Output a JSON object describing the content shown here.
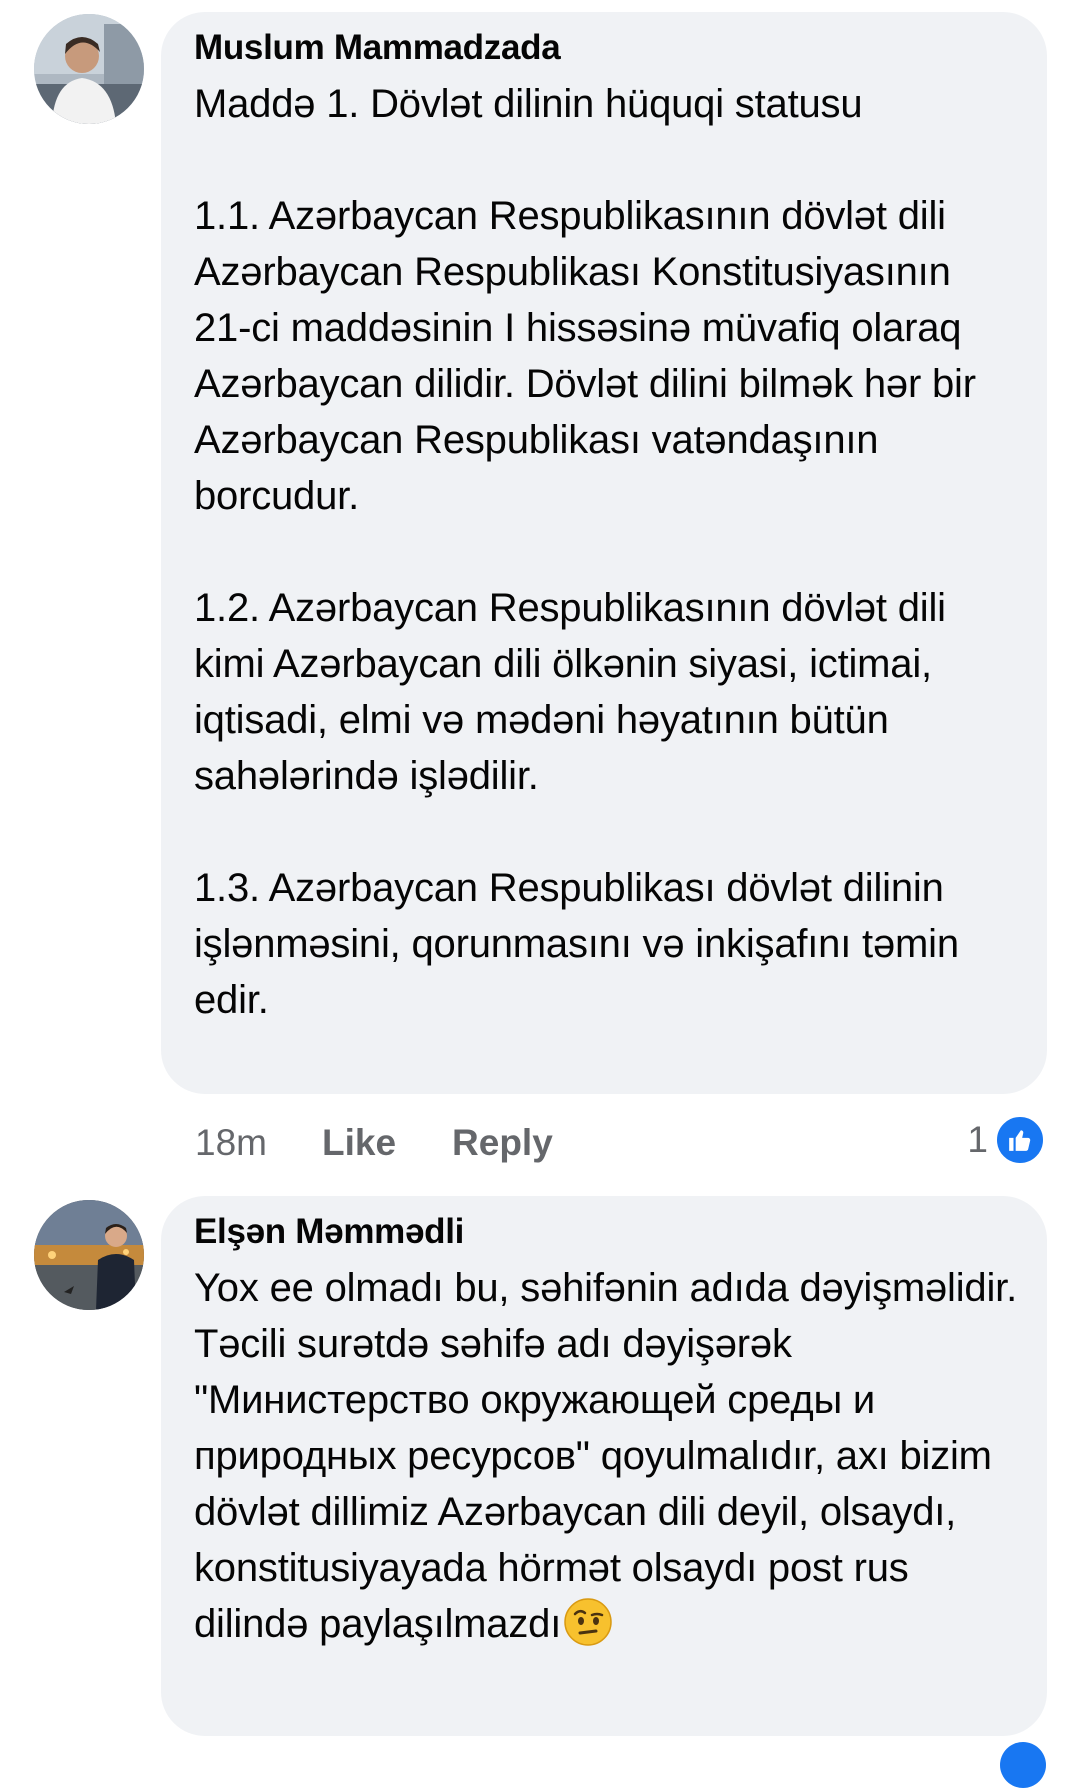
{
  "comments": [
    {
      "author": "Muslum Mammadzada",
      "text": "Maddə 1. Dövlət dilinin hüquqi statusu\n\n1.1. Azərbaycan Respublikasının dövlət dili Azərbaycan Respublikası Konstitusiyasının 21-ci maddəsinin I hissəsinə müvafiq olaraq Azərbaycan dilidir. Dövlət dilini bilmək hər bir Azərbaycan Respublikası vatəndaşının borcudur.\n\n1.2. Azərbaycan Respublikasının dövlət dili kimi Azərbaycan dili ölkənin siyasi, ictimai, iqtisadi, elmi və mədəni həyatının bütün sahələrində işlədilir.\n\n1.3. Azərbaycan Respublikası dövlət dilinin işlənməsini, qorunmasını və inkişafını təmin edir.",
      "time": "18m",
      "like_label": "Like",
      "reply_label": "Reply",
      "reaction_count": "1",
      "reaction_icon": "like-thumb-icon"
    },
    {
      "author": "Elşən Məmmədli",
      "text": "Yox ee olmadı bu, səhifənin adıda dəyişməlidir. Təcili surətdə səhifə adı dəyişərək \"Министерство окружающей среды и природных ресурсов\" qoyulmalıdır, axı bizim dövlət dillimiz Azərbaycan dili deyil, olsaydı, konstitusiyayada hörmət olsaydı post rus dilində paylaşılmazdı",
      "trailing_emoji": "face-with-raised-eyebrow-icon"
    }
  ],
  "colors": {
    "bubble": "#f0f2f5",
    "meta_text": "#65676b",
    "accent": "#1877f2"
  }
}
